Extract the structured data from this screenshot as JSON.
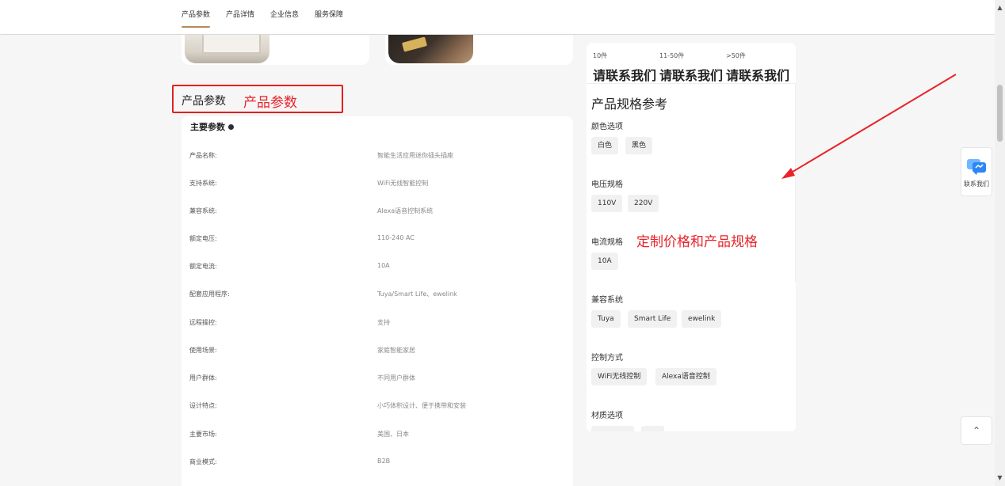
{
  "nav": {
    "tabs": [
      {
        "label": "产品参数",
        "active": true
      },
      {
        "label": "产品详情",
        "active": false
      },
      {
        "label": "企业信息",
        "active": false
      },
      {
        "label": "服务保障",
        "active": false
      }
    ]
  },
  "section": {
    "title": "产品参数",
    "annotation": "产品参数"
  },
  "params": {
    "heading": "主要参数",
    "rows": [
      {
        "label": "产品名称:",
        "value": "智能生活应用迷你插头插座"
      },
      {
        "label": "支持系统:",
        "value": "WiFi无线智能控制"
      },
      {
        "label": "兼容系统:",
        "value": "Alexa语音控制系统"
      },
      {
        "label": "额定电压:",
        "value": "110-240 AC"
      },
      {
        "label": "额定电流:",
        "value": "10A"
      },
      {
        "label": "配套应用程序:",
        "value": "Tuya/Smart Life、ewelink"
      },
      {
        "label": "远程操控:",
        "value": "支持"
      },
      {
        "label": "使用场景:",
        "value": "家庭智能家居"
      },
      {
        "label": "用户群体:",
        "value": "不同用户群体"
      },
      {
        "label": "设计特点:",
        "value": "小巧体积设计、便于携带和安装"
      },
      {
        "label": "主要市场:",
        "value": "美国、日本"
      },
      {
        "label": "商业模式:",
        "value": "B2B"
      }
    ]
  },
  "pricing": {
    "tiers": [
      {
        "qty": "10件",
        "price": "请联系我们"
      },
      {
        "qty": "11-50件",
        "price": "请联系我们"
      },
      {
        "qty": ">50件",
        "price": "请联系我们"
      }
    ]
  },
  "specs": {
    "title": "产品规格参考",
    "annotation": "定制价格和产品规格",
    "groups": [
      {
        "label": "颜色选项",
        "options": [
          "白色",
          "黑色"
        ]
      },
      {
        "label": "电压规格",
        "options": [
          "110V",
          "220V"
        ]
      },
      {
        "label": "电流规格",
        "options": [
          "10A"
        ]
      },
      {
        "label": "兼容系统",
        "options": [
          "Tuya",
          "Smart Life",
          "ewelink"
        ]
      },
      {
        "label": "控制方式",
        "options": [
          "WiFi无线控制",
          "Alexa语音控制"
        ]
      },
      {
        "label": "材质选项",
        "options": [
          "",
          ""
        ]
      }
    ]
  },
  "widgets": {
    "contact_label": "联系我们",
    "contact_icon": "chat-bubble-icon",
    "back_top_icon": "chevron-up-icon"
  },
  "colors": {
    "accent": "#b58a5a",
    "annotation_red": "#e8232a"
  }
}
